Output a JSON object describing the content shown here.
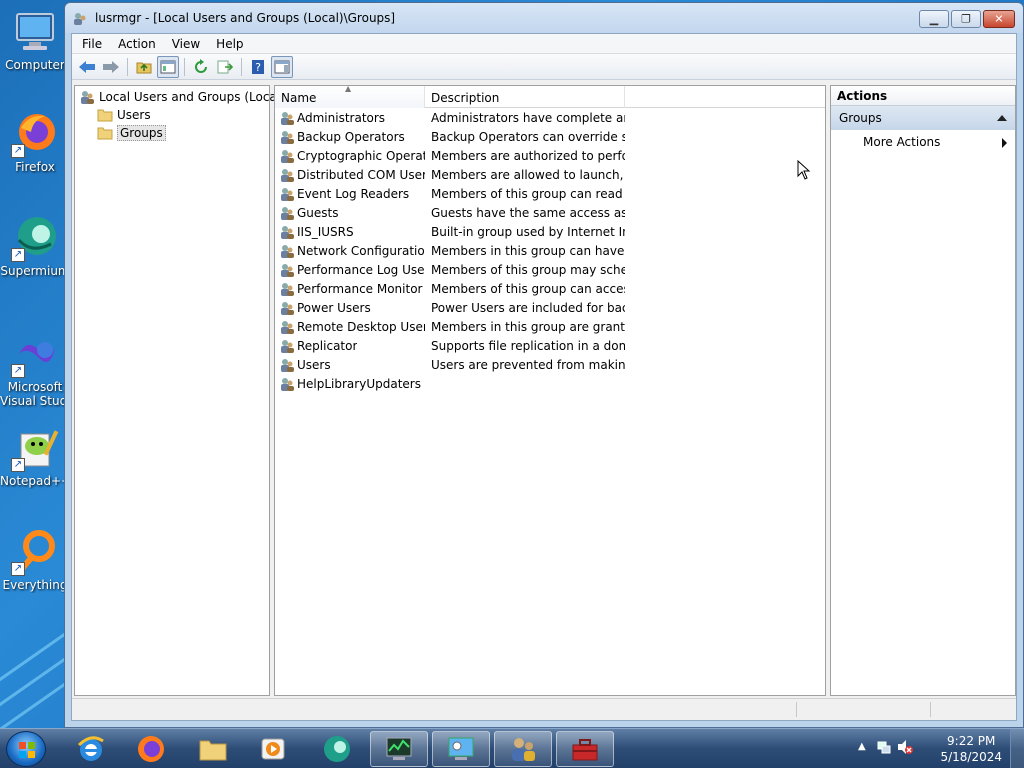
{
  "desktop": {
    "icons": [
      {
        "label": "Computer"
      },
      {
        "label": "Firefox"
      },
      {
        "label": "Supermium"
      },
      {
        "label": "Microsoft Visual Studio",
        "line1": "Microsoft",
        "line2": "Visual Studio"
      },
      {
        "label": "Notepad++"
      },
      {
        "label": "Everything"
      }
    ]
  },
  "window": {
    "title": "lusrmgr - [Local Users and Groups (Local)\\Groups]",
    "menu": [
      "File",
      "Action",
      "View",
      "Help"
    ]
  },
  "tree": {
    "root": "Local Users and Groups (Local)",
    "children": [
      "Users",
      "Groups"
    ],
    "selected": "Groups"
  },
  "list": {
    "columns": [
      "Name",
      "Description"
    ],
    "rows": [
      {
        "name": "Administrators",
        "description": "Administrators have complete an..."
      },
      {
        "name": "Backup Operators",
        "description": "Backup Operators can override se..."
      },
      {
        "name": "Cryptographic Operat...",
        "description": "Members are authorized to perfor..."
      },
      {
        "name": "Distributed COM Users",
        "description": "Members are allowed to launch, a..."
      },
      {
        "name": "Event Log Readers",
        "description": "Members of this group can read e..."
      },
      {
        "name": "Guests",
        "description": "Guests have the same access as m..."
      },
      {
        "name": "IIS_IUSRS",
        "description": "Built-in group used by Internet Inf..."
      },
      {
        "name": "Network Configuratio...",
        "description": "Members in this group can have s..."
      },
      {
        "name": "Performance Log Users",
        "description": "Members of this group may sche..."
      },
      {
        "name": "Performance Monitor ...",
        "description": "Members of this group can acces..."
      },
      {
        "name": "Power Users",
        "description": "Power Users are included for back..."
      },
      {
        "name": "Remote Desktop Users",
        "description": "Members in this group are grante..."
      },
      {
        "name": "Replicator",
        "description": "Supports file replication in a dom..."
      },
      {
        "name": "Users",
        "description": "Users are prevented from making ..."
      },
      {
        "name": "HelpLibraryUpdaters",
        "description": ""
      }
    ]
  },
  "actions": {
    "title": "Actions",
    "group": "Groups",
    "items": [
      "More Actions"
    ]
  },
  "taskbar": {
    "time": "9:22 PM",
    "date": "5/18/2024"
  },
  "colors": {
    "accent": "#1f77c4",
    "selection": "#e5e5e5"
  }
}
